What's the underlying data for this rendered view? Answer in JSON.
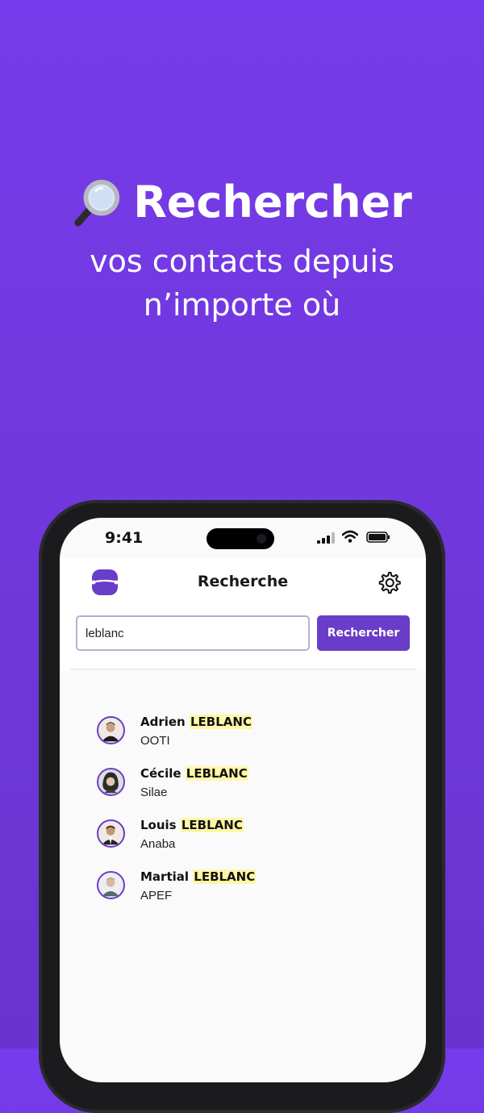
{
  "hero": {
    "title": "Rechercher",
    "subtitle_line1": "vos contacts depuis",
    "subtitle_line2": "n’importe où"
  },
  "status_bar": {
    "time": "9:41"
  },
  "app": {
    "title": "Recherche",
    "search": {
      "value": "leblanc",
      "button_label": "Rechercher"
    }
  },
  "results": [
    {
      "first_name": "Adrien",
      "last_name": "LEBLANC",
      "company": "OOTI"
    },
    {
      "first_name": "Cécile",
      "last_name": "LEBLANC",
      "company": "Silae"
    },
    {
      "first_name": "Louis",
      "last_name": "LEBLANC",
      "company": "Anaba"
    },
    {
      "first_name": "Martial",
      "last_name": "LEBLANC",
      "company": "APEF"
    }
  ],
  "colors": {
    "background": "#763bea",
    "accent": "#6a3dc9",
    "highlight": "#fff6a8"
  },
  "icons": [
    "magnifying-glass-icon",
    "app-logo",
    "gear-icon",
    "signal-icon",
    "wifi-icon",
    "battery-icon"
  ]
}
